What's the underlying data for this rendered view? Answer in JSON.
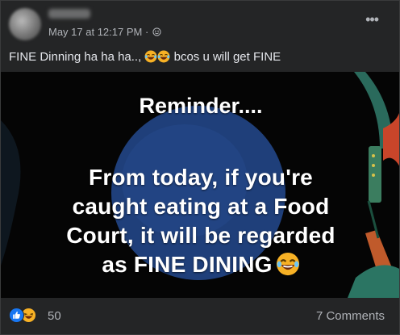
{
  "post": {
    "timestamp": "May 17 at 12:17 PM · ",
    "privacy_icon": "globe-icon",
    "menu_icon": "more-options-icon",
    "caption_prefix": "FINE Dinning ha ha ha..,",
    "caption_emojis": [
      "laughing-emoji",
      "laughing-emoji"
    ],
    "caption_suffix": "bcos u will get FINE"
  },
  "image": {
    "title": "Reminder....",
    "body_lines": [
      "From today, if you're",
      "caught eating at a Food",
      "Court, it will be regarded",
      "as FINE DINING"
    ],
    "trailing_emoji": "laughing-emoji"
  },
  "footer": {
    "reaction_icons": [
      "like-reaction-icon",
      "haha-reaction-icon"
    ],
    "reaction_count": "50",
    "comments": "7 Comments"
  },
  "colors": {
    "card_bg": "#242526",
    "text_primary": "#e4e6eb",
    "text_secondary": "#b0b3b8",
    "meme_circle": "#244a8a",
    "like_blue": "#1877f2",
    "haha_yellow": "#f7b125"
  }
}
